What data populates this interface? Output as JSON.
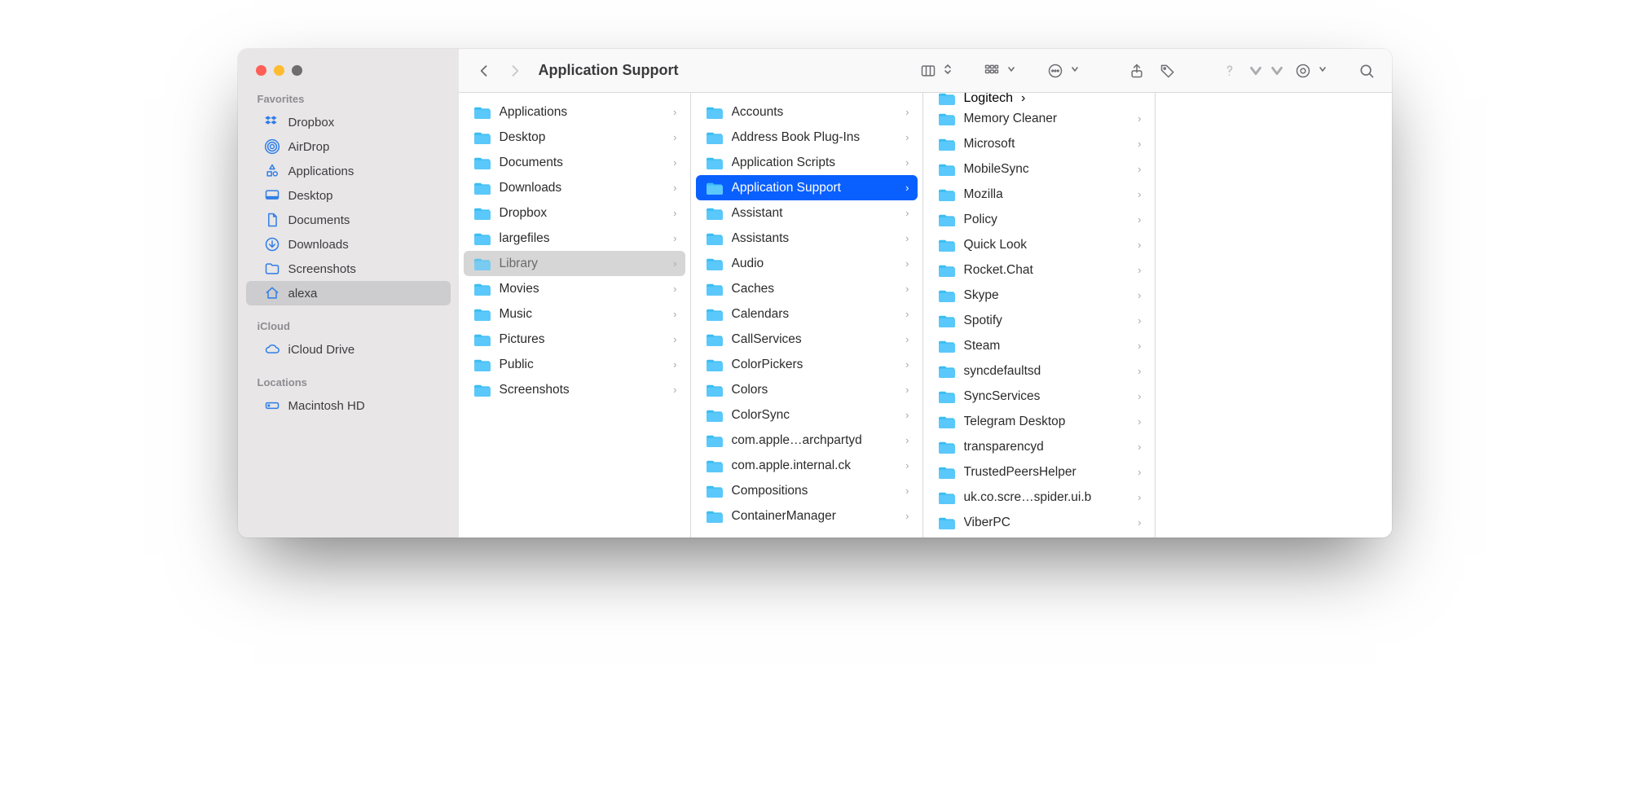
{
  "window_title": "Application Support",
  "sidebar": {
    "sections": [
      {
        "label": "Favorites",
        "items": [
          {
            "icon": "dropbox",
            "label": "Dropbox",
            "selected": false
          },
          {
            "icon": "airdrop",
            "label": "AirDrop",
            "selected": false
          },
          {
            "icon": "apps",
            "label": "Applications",
            "selected": false
          },
          {
            "icon": "desktop",
            "label": "Desktop",
            "selected": false
          },
          {
            "icon": "doc",
            "label": "Documents",
            "selected": false
          },
          {
            "icon": "download",
            "label": "Downloads",
            "selected": false
          },
          {
            "icon": "folder",
            "label": "Screenshots",
            "selected": false
          },
          {
            "icon": "home",
            "label": "alexa",
            "selected": true
          }
        ]
      },
      {
        "label": "iCloud",
        "items": [
          {
            "icon": "cloud",
            "label": "iCloud Drive",
            "selected": false
          }
        ]
      },
      {
        "label": "Locations",
        "items": [
          {
            "icon": "disk",
            "label": "Macintosh HD",
            "selected": false
          }
        ]
      }
    ]
  },
  "columns": [
    {
      "partial_top": null,
      "items": [
        {
          "label": "Applications",
          "state": "normal"
        },
        {
          "label": "Desktop",
          "state": "normal"
        },
        {
          "label": "Documents",
          "state": "normal"
        },
        {
          "label": "Downloads",
          "state": "normal"
        },
        {
          "label": "Dropbox",
          "state": "normal"
        },
        {
          "label": "largefiles",
          "state": "normal"
        },
        {
          "label": "Library",
          "state": "path"
        },
        {
          "label": "Movies",
          "state": "normal"
        },
        {
          "label": "Music",
          "state": "normal"
        },
        {
          "label": "Pictures",
          "state": "normal"
        },
        {
          "label": "Public",
          "state": "normal"
        },
        {
          "label": "Screenshots",
          "state": "normal"
        }
      ]
    },
    {
      "partial_top": null,
      "items": [
        {
          "label": "Accounts",
          "state": "normal"
        },
        {
          "label": "Address Book Plug-Ins",
          "state": "normal"
        },
        {
          "label": "Application Scripts",
          "state": "normal"
        },
        {
          "label": "Application Support",
          "state": "selected"
        },
        {
          "label": "Assistant",
          "state": "normal"
        },
        {
          "label": "Assistants",
          "state": "normal"
        },
        {
          "label": "Audio",
          "state": "normal"
        },
        {
          "label": "Caches",
          "state": "normal"
        },
        {
          "label": "Calendars",
          "state": "normal"
        },
        {
          "label": "CallServices",
          "state": "normal"
        },
        {
          "label": "ColorPickers",
          "state": "normal"
        },
        {
          "label": "Colors",
          "state": "normal"
        },
        {
          "label": "ColorSync",
          "state": "normal"
        },
        {
          "label": "com.apple…archpartyd",
          "state": "normal"
        },
        {
          "label": "com.apple.internal.ck",
          "state": "normal"
        },
        {
          "label": "Compositions",
          "state": "normal"
        },
        {
          "label": "ContainerManager",
          "state": "normal"
        }
      ]
    },
    {
      "partial_top": {
        "label": "Logitech"
      },
      "items": [
        {
          "label": "Memory Cleaner",
          "state": "normal"
        },
        {
          "label": "Microsoft",
          "state": "normal"
        },
        {
          "label": "MobileSync",
          "state": "normal"
        },
        {
          "label": "Mozilla",
          "state": "normal"
        },
        {
          "label": "Policy",
          "state": "normal"
        },
        {
          "label": "Quick Look",
          "state": "normal"
        },
        {
          "label": "Rocket.Chat",
          "state": "normal"
        },
        {
          "label": "Skype",
          "state": "normal"
        },
        {
          "label": "Spotify",
          "state": "normal"
        },
        {
          "label": "Steam",
          "state": "normal"
        },
        {
          "label": "syncdefaultsd",
          "state": "normal"
        },
        {
          "label": "SyncServices",
          "state": "normal"
        },
        {
          "label": "Telegram Desktop",
          "state": "normal"
        },
        {
          "label": "transparencyd",
          "state": "normal"
        },
        {
          "label": "TrustedPeersHelper",
          "state": "normal"
        },
        {
          "label": "uk.co.scre…spider.ui.b",
          "state": "normal"
        },
        {
          "label": "ViberPC",
          "state": "normal"
        }
      ]
    },
    {
      "partial_top": null,
      "items": []
    }
  ]
}
